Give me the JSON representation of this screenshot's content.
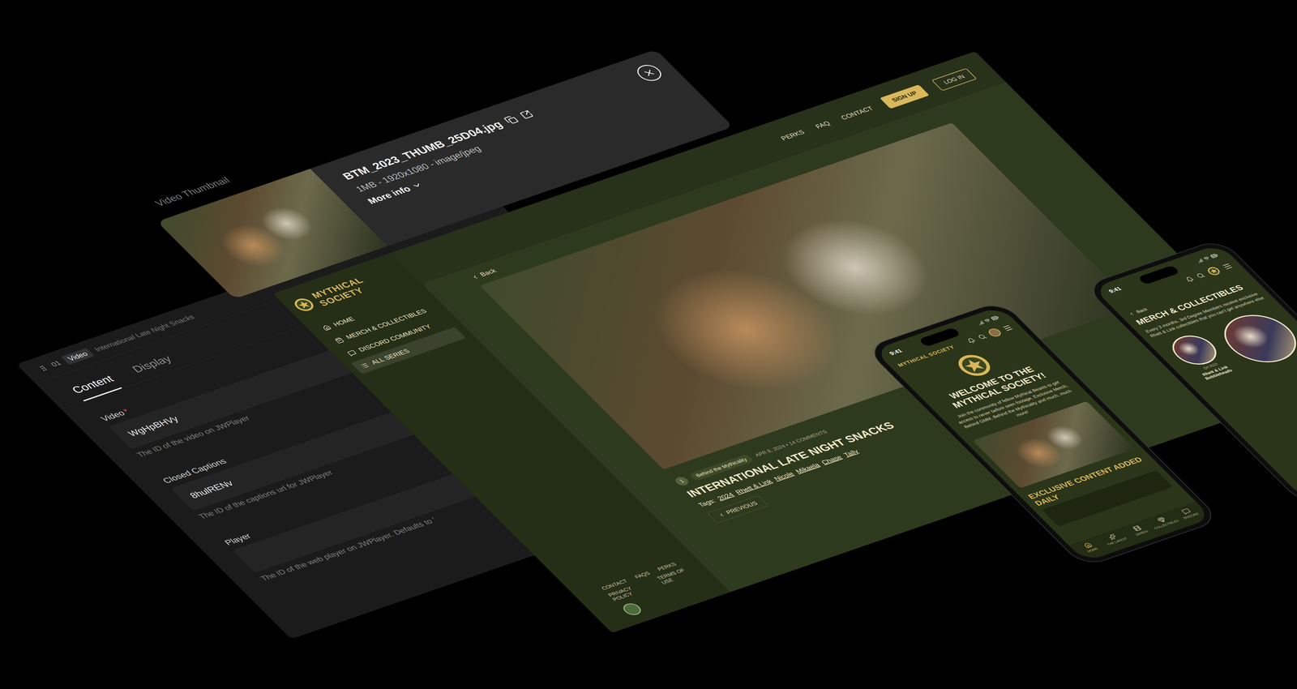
{
  "thumbnail_card": {
    "label": "Video Thumbnail",
    "filename": "BTM_2023_THUMB_25D04.jpg",
    "meta": "1MB - 1920x1080 - image/jpeg",
    "more": "More info"
  },
  "editor": {
    "index": "01",
    "type": "Video",
    "title": "International Late Night Snacks",
    "required_mark": "*",
    "tabs": [
      {
        "label": "Content",
        "selected": true
      },
      {
        "label": "Display",
        "selected": false
      }
    ],
    "fields": [
      {
        "label": "Video",
        "required": true,
        "value": "WgHpBHVy",
        "help": "The ID of the video on JWPlayer"
      },
      {
        "label": "Closed Captions",
        "required": false,
        "value": "8hulRENv",
        "help": "The ID of the captions url for JWPlayer"
      },
      {
        "label": "Player",
        "required": false,
        "value": "",
        "help": "The ID of the web player on JWPlayer. Defaults to '"
      }
    ]
  },
  "desktop": {
    "logo": "MYTHICAL SOCIETY",
    "nav": [
      "PERKS",
      "FAQ",
      "CONTACT"
    ],
    "sign_up": "SIGN UP",
    "log_in": "LOG IN",
    "sidebar": [
      {
        "label": "HOME",
        "selected": false
      },
      {
        "label": "MERCH & COLLECTIBLES",
        "selected": false
      },
      {
        "label": "DISCORD COMMUNITY",
        "selected": false
      },
      {
        "label": "ALL SERIES",
        "selected": true
      }
    ],
    "back": "Back",
    "episode": {
      "number": "1",
      "series": "Behind the Mythicality",
      "date": "APR 8, 2024 • 14 COMMENTS",
      "title": "INTERNATIONAL LATE NIGHT SNACKS",
      "tags_label": "Tags:",
      "tags": [
        "2024",
        "Rhett & Link",
        "Nicole",
        "Mikaela",
        "Chase",
        "Tally"
      ],
      "previous": "PREVIOUS"
    },
    "footer": [
      [
        "CONTACT",
        "FAQS",
        "PERKS"
      ],
      [
        "PRIVACY POLICY",
        "TERMS OF USE"
      ]
    ]
  },
  "phone_welcome": {
    "time": "9:41",
    "logo": "MYTHICAL SOCIETY",
    "title": "WELCOME TO THE MYTHICAL SOCIETY!",
    "body": "Join the community of fellow Mythical Beasts to get access to never before seen footage, Exclusive Merch, Behind GMM, Behind the Mythicality and much, much more!",
    "section": "EXCLUSIVE CONTENT ADDED DAILY",
    "tabbar": [
      {
        "label": "HOME",
        "selected": true
      },
      {
        "label": "THE LATEST",
        "selected": false
      },
      {
        "label": "SERIES",
        "selected": false
      },
      {
        "label": "COLLECTIBLES",
        "selected": false
      },
      {
        "label": "DISCORD",
        "selected": false
      }
    ]
  },
  "phone_merch": {
    "time": "9:41",
    "back": "Back",
    "title": "MERCH & COLLECTIBLES",
    "body": "Every 3 months, 3rd Degree Members receive exclusive Rhett & Link collectibles that you can't get anywhere else",
    "products": [
      {
        "date": "Q4 2023",
        "name": "Rhett & Link Bobbleheads"
      }
    ]
  }
}
